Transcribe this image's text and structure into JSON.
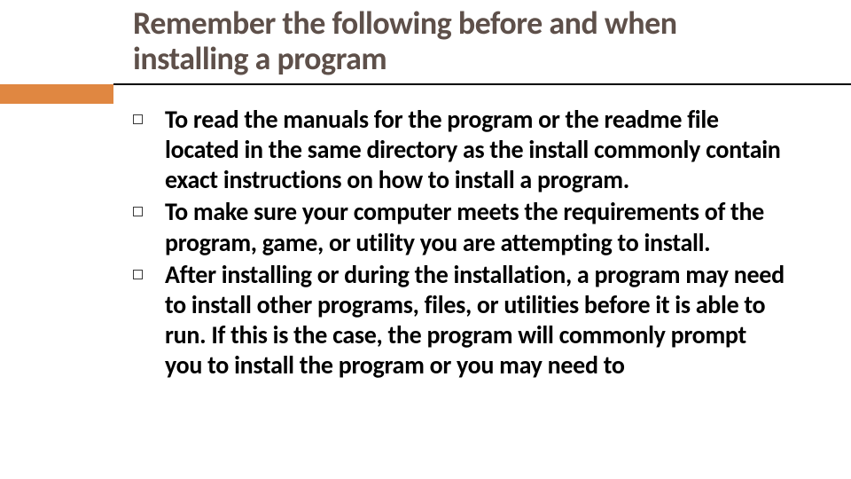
{
  "title": "Remember the following before and when installing a program",
  "bullets": [
    "To read the manuals for the program or the readme file located in the same directory as the install commonly contain exact instructions on how to install a program.",
    "To make sure your computer meets the requirements of the program, game, or utility you are attempting to install.",
    "After installing or during the installation, a program may need to install other programs, files, or utilities before it is able to run. If this is the case, the program will commonly prompt you to install the program or you may need to"
  ],
  "accent_color": "#e08741"
}
